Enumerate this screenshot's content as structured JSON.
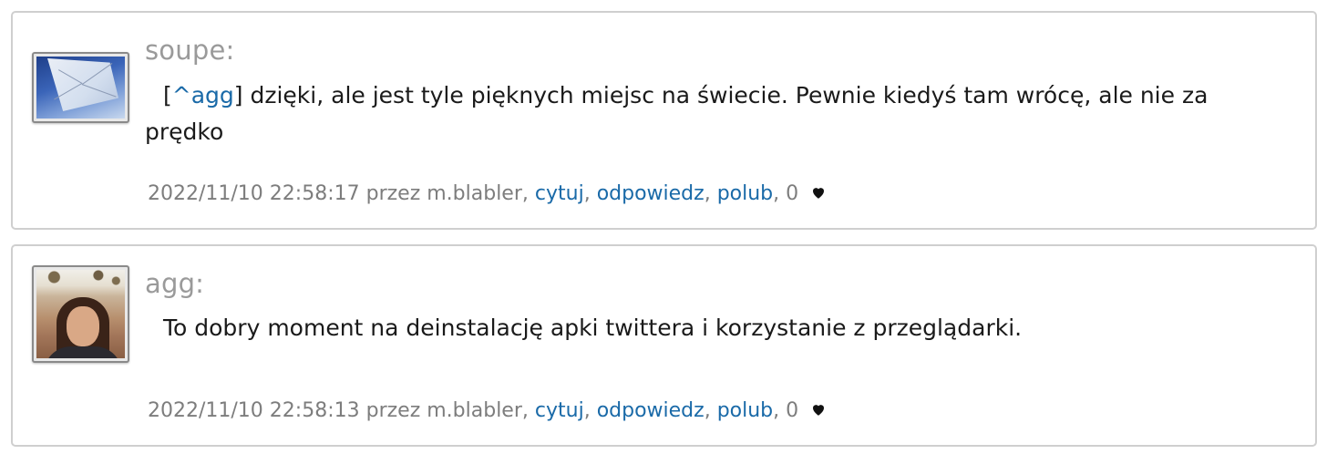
{
  "posts": [
    {
      "author": "soupe:",
      "avatar_icon": "umbrella-photo",
      "reply_prefix_open": "[",
      "reply_link": "^agg",
      "reply_prefix_close": "]",
      "text": " dzięki, ale jest tyle pięknych miejsc na świecie. Pewnie kiedyś tam wrócę, ale nie za prędko",
      "timestamp": "2022/11/10 22:58:17",
      "by_label": "przez",
      "by_user": "m.blabler",
      "quote_label": "cytuj",
      "reply_label": "odpowiedz",
      "like_label": "polub",
      "likes": "0",
      "heart_icon": "heart-icon"
    },
    {
      "author": "agg:",
      "avatar_icon": "portrait-photo",
      "text": "To dobry moment na deinstalację apki twittera i korzystanie z przeglądarki.",
      "timestamp": "2022/11/10 22:58:13",
      "by_label": "przez",
      "by_user": "m.blabler",
      "quote_label": "cytuj",
      "reply_label": "odpowiedz",
      "like_label": "polub",
      "likes": "0",
      "heart_icon": "heart-icon"
    }
  ],
  "colors": {
    "link": "#1a6aa8",
    "author": "#9a9a9a",
    "meta": "#7d7d7d",
    "border": "#cfcfcf"
  }
}
